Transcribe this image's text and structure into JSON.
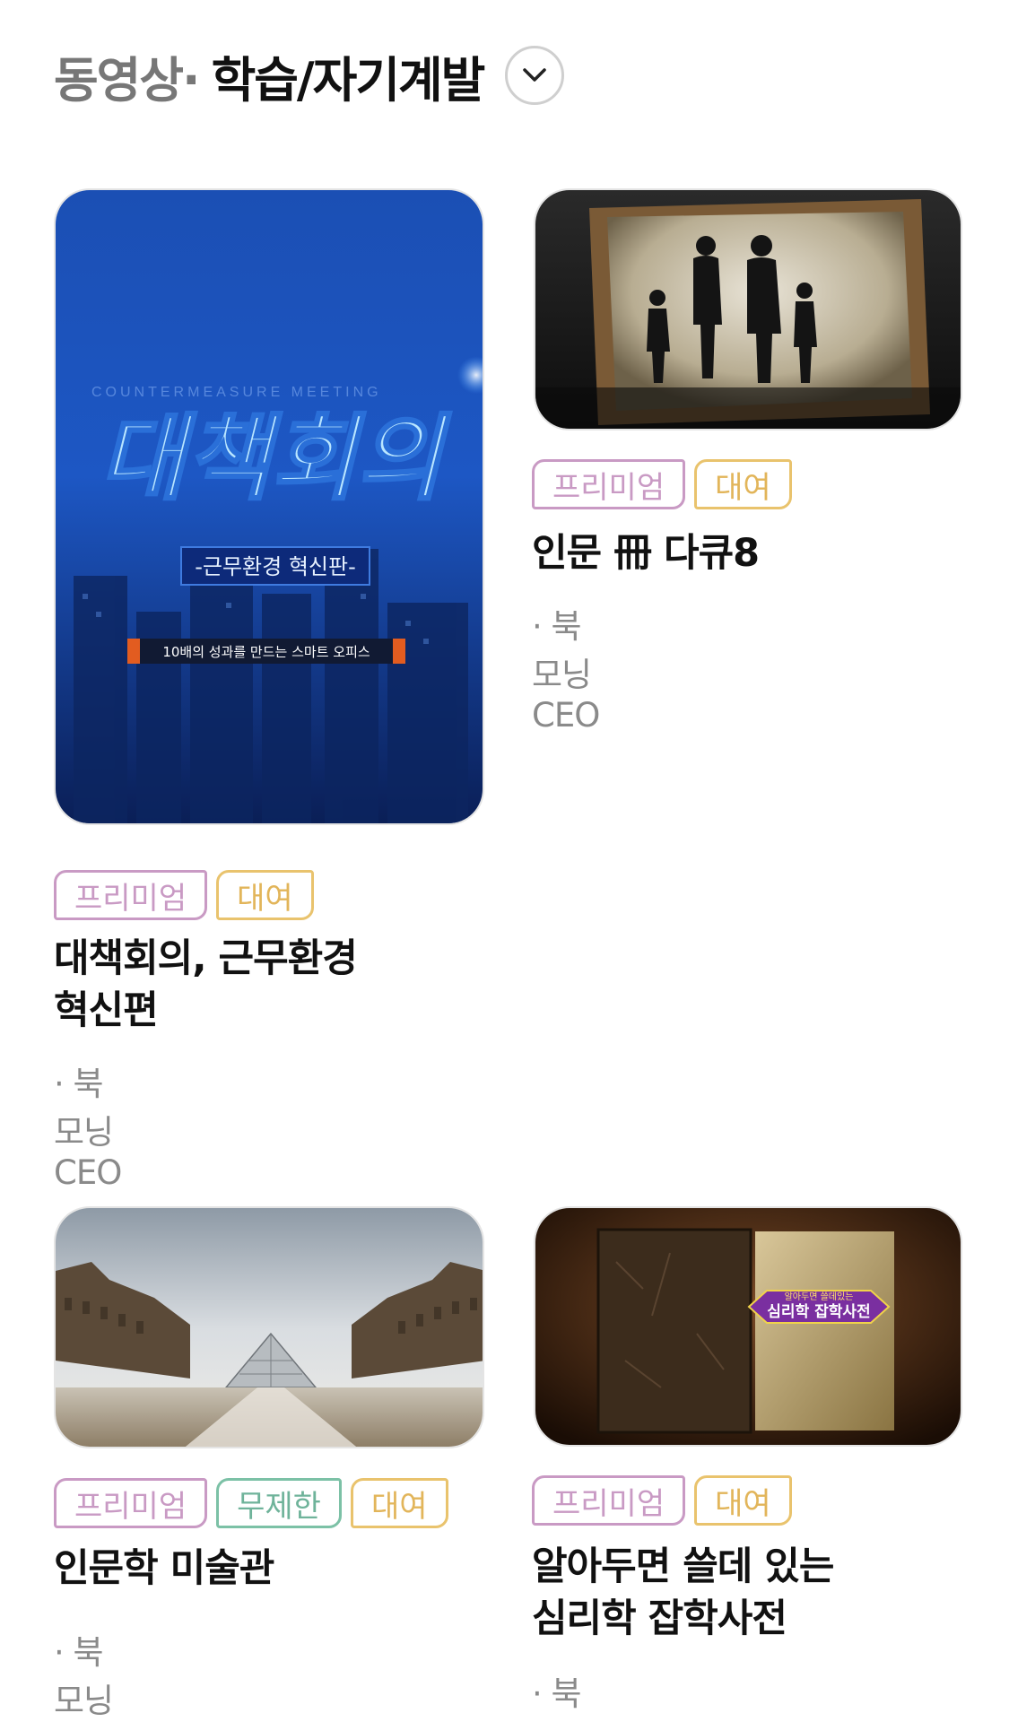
{
  "header": {
    "prefix": "동영상·",
    "title": "학습/자기계발"
  },
  "items": [
    {
      "thumb_text": "대책회의",
      "thumb_subtitle": "-근무환경 혁신판-",
      "thumb_caption": "10배의 성과를 만드는 스마트 오피스",
      "thumb_en": "COUNTERMEASURE MEETING",
      "badges": [
        "프리미엄",
        "대여"
      ],
      "title_line1": "대책회의, 근무환경",
      "title_line2": "혁신편",
      "author": "· 북모닝CEO"
    },
    {
      "badges": [
        "프리미엄",
        "대여"
      ],
      "title_line1": "인문 冊 다큐8",
      "author": "· 북모닝CEO"
    },
    {
      "badges": [
        "프리미엄",
        "무제한",
        "대여"
      ],
      "title_line1": "인문학 미술관",
      "author": "· 북모닝CEO"
    },
    {
      "thumb_small": "알아두면 쓸데있는",
      "thumb_main": "심리학 잡학사전",
      "badges": [
        "프리미엄",
        "대여"
      ],
      "title_line1": "알아두면 쓸데 있는",
      "title_line2": "심리학 잡학사전",
      "author": "· 북모닝CEO"
    }
  ]
}
